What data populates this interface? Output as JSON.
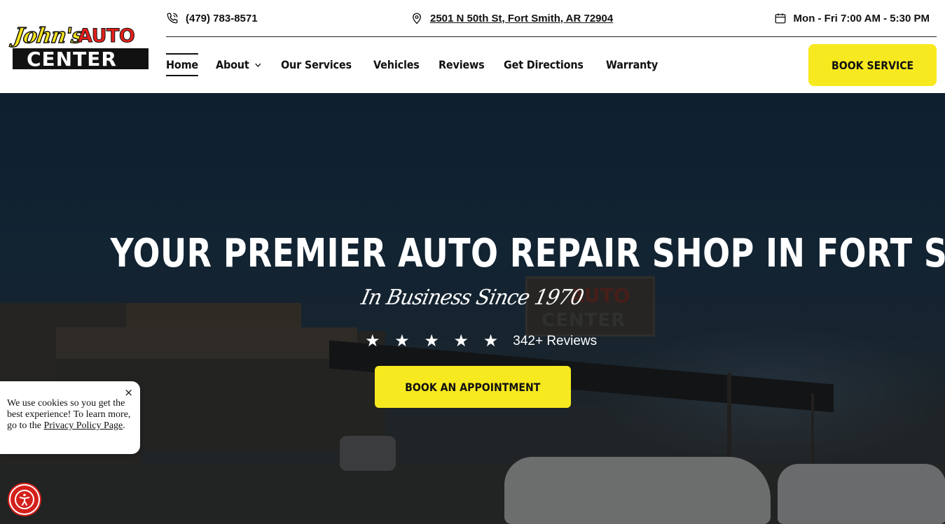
{
  "brand": {
    "logo_script": "John's",
    "logo_auto": "AUTO",
    "logo_center": "CENTER"
  },
  "topbar": {
    "phone": "(479) 783-8571",
    "address": "2501 N 50th St, Fort Smith, AR 72904",
    "hours": "Mon - Fri 7:00 AM - 5:30 PM"
  },
  "nav": {
    "items": [
      {
        "label": "Home"
      },
      {
        "label": "About"
      },
      {
        "label": "Our Services"
      },
      {
        "label": "Vehicles"
      },
      {
        "label": "Reviews"
      },
      {
        "label": "Get Directions"
      },
      {
        "label": "Warranty"
      }
    ],
    "book_label": "BOOK SERVICE"
  },
  "hero": {
    "title": "YOUR PREMIER AUTO REPAIR SHOP IN FORT SMITH, AR",
    "subtitle": "In Business Since 1970",
    "stars": "★ ★ ★ ★ ★",
    "rating_value": 5,
    "reviews": "342+ Reviews",
    "cta": "BOOK AN APPOINTMENT",
    "sign_line1": "AUTO",
    "sign_line2": "CENTER"
  },
  "cookie": {
    "text": "We use cookies so you get the best experience! To learn more, go to the",
    "link": "Privacy Policy Page",
    "suffix": ".",
    "close": "×"
  },
  "colors": {
    "accent_yellow": "#f7e91f",
    "brand_red": "#e3201b",
    "accessibility_red": "#d4201b"
  }
}
